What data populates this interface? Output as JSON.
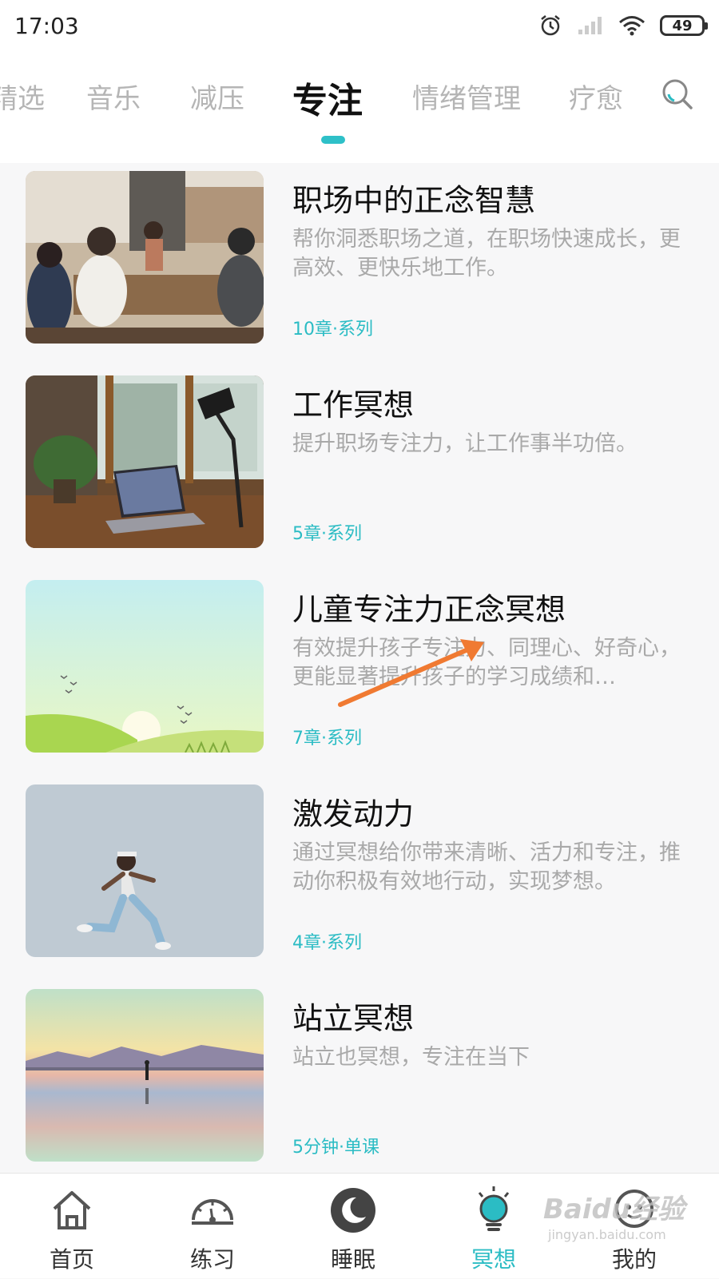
{
  "status_bar": {
    "time": "17:03",
    "battery": "49"
  },
  "tabs": [
    {
      "label": "精选"
    },
    {
      "label": "音乐"
    },
    {
      "label": "减压"
    },
    {
      "label": "专注"
    },
    {
      "label": "情绪管理"
    },
    {
      "label": "疗愈"
    }
  ],
  "active_tab": "专注",
  "accent_color": "#2bbcc4",
  "items": [
    {
      "title": "职场中的正念智慧",
      "desc": "帮你洞悉职场之道，在职场快速成长，更高效、更快乐地工作。",
      "meta": "10章·系列",
      "image": "team-meeting-photo"
    },
    {
      "title": "工作冥想",
      "desc": "提升职场专注力，让工作事半功倍。",
      "meta": "5章·系列",
      "image": "laptop-desk-photo"
    },
    {
      "title": "儿童专注力正念冥想",
      "desc": "有效提升孩子专注力、同理心、好奇心，更能显著提升孩子的学习成绩和…",
      "meta": "7章·系列",
      "image": "green-hills-illustration"
    },
    {
      "title": "激发动力",
      "desc": "通过冥想给你带来清晰、活力和专注，推动你积极有效地行动，实现梦想。",
      "meta": "4章·系列",
      "image": "jumping-woman-photo"
    },
    {
      "title": "站立冥想",
      "desc": "站立也冥想，专注在当下",
      "meta": "5分钟·单课",
      "image": "salt-flat-reflection-photo"
    }
  ],
  "bottom_nav": [
    {
      "label": "首页",
      "icon": "home-icon"
    },
    {
      "label": "练习",
      "icon": "gauge-icon"
    },
    {
      "label": "睡眠",
      "icon": "moon-icon"
    },
    {
      "label": "冥想",
      "icon": "bulb-icon"
    },
    {
      "label": "我的",
      "icon": "smiley-icon"
    }
  ],
  "watermark": {
    "text": "Baidu经验",
    "sub": "jingyan.baidu.com"
  }
}
